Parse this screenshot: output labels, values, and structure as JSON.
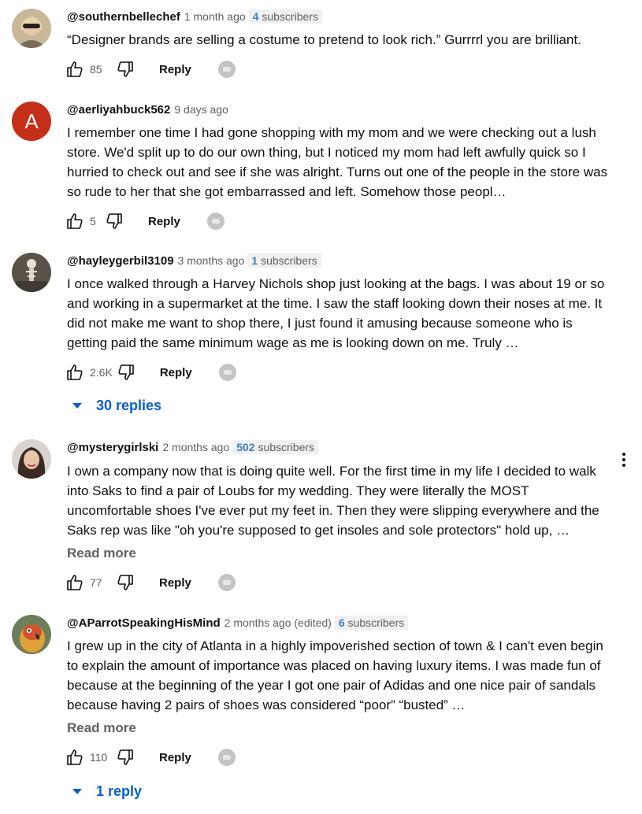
{
  "comments": [
    {
      "handle": "@southernbellechef",
      "time": "1 month ago",
      "subs_count": "4",
      "subs_label": "subscribers",
      "text": "“Designer brands are selling a costume to pretend to look rich.” Gurrrrl you are brilliant.",
      "read_more": "",
      "likes": "85",
      "reply_label": "Reply",
      "replies": ""
    },
    {
      "handle": "@aerliyahbuck562",
      "time": "9 days ago",
      "avatar_letter": "A",
      "text": "I remember one time I had gone shopping with my mom and we were checking out a lush store. We'd split up to do our own thing, but I noticed my mom had left awfully quick so I hurried to check out and see if she was alright. Turns out one of the people in the store was so rude to her that she got embarrassed and left. Somehow those peopl…",
      "likes": "5",
      "reply_label": "Reply"
    },
    {
      "handle": "@hayleygerbil3109",
      "time": "3 months ago",
      "subs_count": "1",
      "subs_label": "subscribers",
      "text": "I once walked through a Harvey Nichols shop just looking at the bags. I was about 19 or so and working in a supermarket at the time. I saw the staff looking down their noses at me. It did not make me want to shop there, I just found it amusing because someone who is getting paid the same minimum wage as me is looking down on me. Truly …",
      "likes": "2.6K",
      "reply_label": "Reply",
      "replies": "30 replies"
    },
    {
      "handle": "@mysterygirlski",
      "time": "2 months ago",
      "subs_count": "502",
      "subs_label": "subscribers",
      "text": "I own a company now that is doing quite well. For the first time in my life I decided to walk into Saks to find a pair of Loubs for my wedding. They were literally the MOST uncomfortable shoes I've ever put my feet in. Then they were slipping everywhere and the Saks rep was like \"oh you're supposed to get insoles and sole protectors\" hold up, …",
      "read_more": "Read more",
      "likes": "77",
      "reply_label": "Reply"
    },
    {
      "handle": "@AParrotSpeakingHisMind",
      "time": "2 months ago (edited)",
      "subs_count": "6",
      "subs_label": "subscribers",
      "text": "I grew up in the city of Atlanta in a highly impoverished section of town & I can't even begin to explain the amount of importance was placed on having luxury items. I was made fun of because at the beginning of the year I got one pair of Adidas and one nice pair of sandals because having 2 pairs of shoes was considered “poor” “busted” …",
      "read_more": "Read more",
      "likes": "110",
      "reply_label": "Reply",
      "replies": "1 reply"
    }
  ],
  "colors": {
    "link_blue": "#065fd4",
    "badge_blue": "#3d7fc1",
    "avatar_red": "#c62f17"
  },
  "icons": [
    "thumbs-up-icon",
    "thumbs-down-icon",
    "creator-heart-icon",
    "more-vert-icon",
    "caret-down-icon"
  ]
}
